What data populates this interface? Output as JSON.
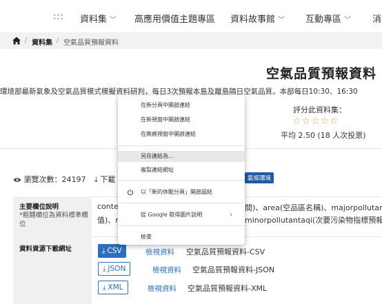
{
  "nav": {
    "dots": ":::",
    "items": [
      "資料集",
      "高應用價值主題專區",
      "資料故事館",
      "互動專區",
      "消息"
    ]
  },
  "breadcrumb": {
    "items": [
      "資料集",
      "空氣品質預報資料"
    ]
  },
  "page": {
    "title": "空氣品質預報資料",
    "description": "環境部最新氣象及空氣品質模式模擬資料研判，每日3次預報本島及離島隔日空氣品質。本部每日10:30、16:30"
  },
  "rating": {
    "label": "評分此資料集：",
    "stars": "☆☆☆☆☆",
    "average": "平均 2.50 (18 人次投票)"
  },
  "stats": {
    "views_label": "瀏覽次數：",
    "views": "24197",
    "download_partial": "下載",
    "tag": "氣候環境"
  },
  "table": {
    "fields_header": "主要欄位說明",
    "fields_note": "*粗體欄位為資料標準欄位",
    "fields_line1_left": "conte",
    "fields_line1_right": "間)、area(空品區名稱)、majorpollutant(",
    "fields_line2_left": "值)、n",
    "fields_line2_right": "minorpollutantaqi(次要污染物指標預報值",
    "resources_header": "資料資源下載網址",
    "resources": [
      {
        "format": "CSV",
        "view": "檢視資料",
        "name": "空氣品質預報資料-CSV"
      },
      {
        "format": "JSON",
        "view": "檢視資料",
        "name": "空氣品質預報資料-JSON"
      },
      {
        "format": "XML",
        "view": "檢視資料",
        "name": "空氣品質預報資料-XML"
      }
    ]
  },
  "context_menu": {
    "items": [
      "在新分頁中開啟連結",
      "在新視窗中開啟連結",
      "在無痕視窗中開啟連結",
      "另存連結為...",
      "複製連結網址",
      "以「新的休眠分頁」開啟超結",
      "從 Google 取得圖片說明",
      "檢查"
    ]
  },
  "colors": {
    "accent": "#2d6fbf",
    "tag_bg": "#1f5aa6",
    "star": "#e8a33d"
  }
}
